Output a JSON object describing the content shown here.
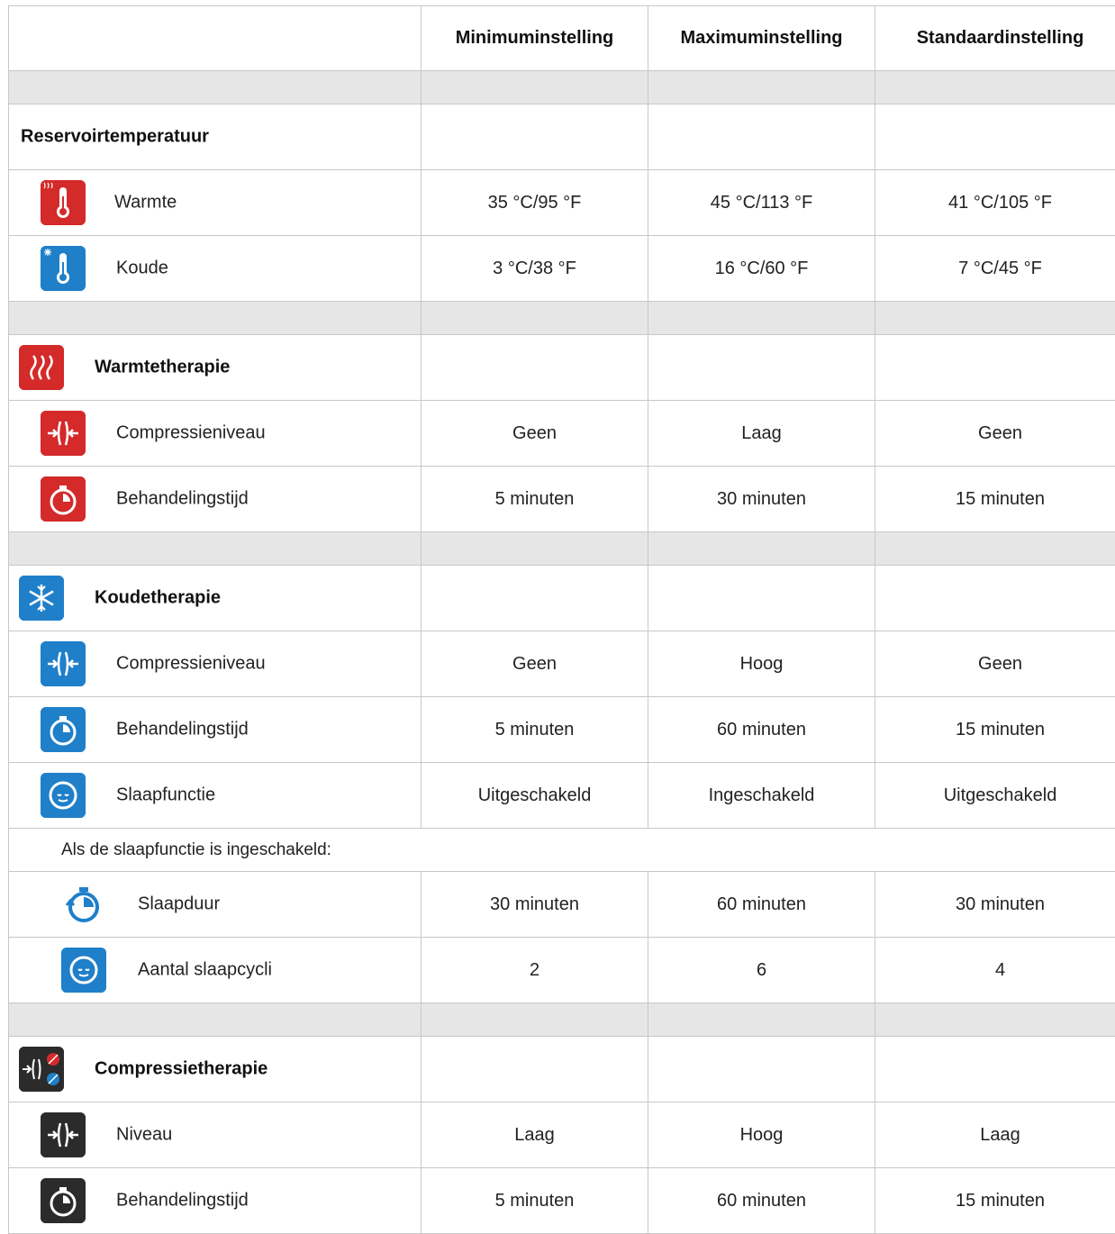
{
  "header": {
    "col_min": "Minimuminstelling",
    "col_max": "Maximuminstelling",
    "col_std": "Standaardinstelling"
  },
  "reservoir": {
    "title": "Reservoirtemperatuur",
    "warm": {
      "label": "Warmte",
      "min": "35 °C/95 °F",
      "max": "45 °C/113 °F",
      "std": "41 °C/105 °F",
      "icon": "heat-thermometer-icon"
    },
    "cold": {
      "label": "Koude",
      "min": "3 °C/38 °F",
      "max": "16 °C/60 °F",
      "std": "7 °C/45 °F",
      "icon": "cold-thermometer-icon"
    }
  },
  "heat_therapy": {
    "title": "Warmtetherapie",
    "icon": "heat-waves-icon",
    "compression": {
      "label": "Compressieniveau",
      "min": "Geen",
      "max": "Laag",
      "std": "Geen"
    },
    "time": {
      "label": "Behandelingstijd",
      "min": "5 minuten",
      "max": "30 minuten",
      "std": "15 minuten"
    }
  },
  "cold_therapy": {
    "title": "Koudetherapie",
    "icon": "snowflake-icon",
    "compression": {
      "label": "Compressieniveau",
      "min": "Geen",
      "max": "Hoog",
      "std": "Geen"
    },
    "time": {
      "label": "Behandelingstijd",
      "min": "5 minuten",
      "max": "60 minuten",
      "std": "15 minuten"
    },
    "sleep": {
      "label": "Slaapfunctie",
      "min": "Uitgeschakeld",
      "max": "Ingeschakeld",
      "std": "Uitgeschakeld"
    },
    "note": "Als de slaapfunctie is ingeschakeld:",
    "sleep_duration": {
      "label": "Slaapduur",
      "min": "30 minuten",
      "max": "60 minuten",
      "std": "30 minuten"
    },
    "sleep_cycles": {
      "label": "Aantal slaapcycli",
      "min": "2",
      "max": "6",
      "std": "4"
    }
  },
  "compression_therapy": {
    "title": "Compressietherapie",
    "icon": "compression-therapy-icon",
    "level": {
      "label": "Niveau",
      "min": "Laag",
      "max": "Hoog",
      "std": "Laag"
    },
    "time": {
      "label": "Behandelingstijd",
      "min": "5 minuten",
      "max": "60 minuten",
      "std": "15 minuten"
    }
  },
  "colors": {
    "heat_red": "#d42a2a",
    "cold_blue": "#1f7fc9",
    "compression_black": "#2b2b2b",
    "border": "#c8c8c8",
    "spacer": "#e6e6e6"
  }
}
